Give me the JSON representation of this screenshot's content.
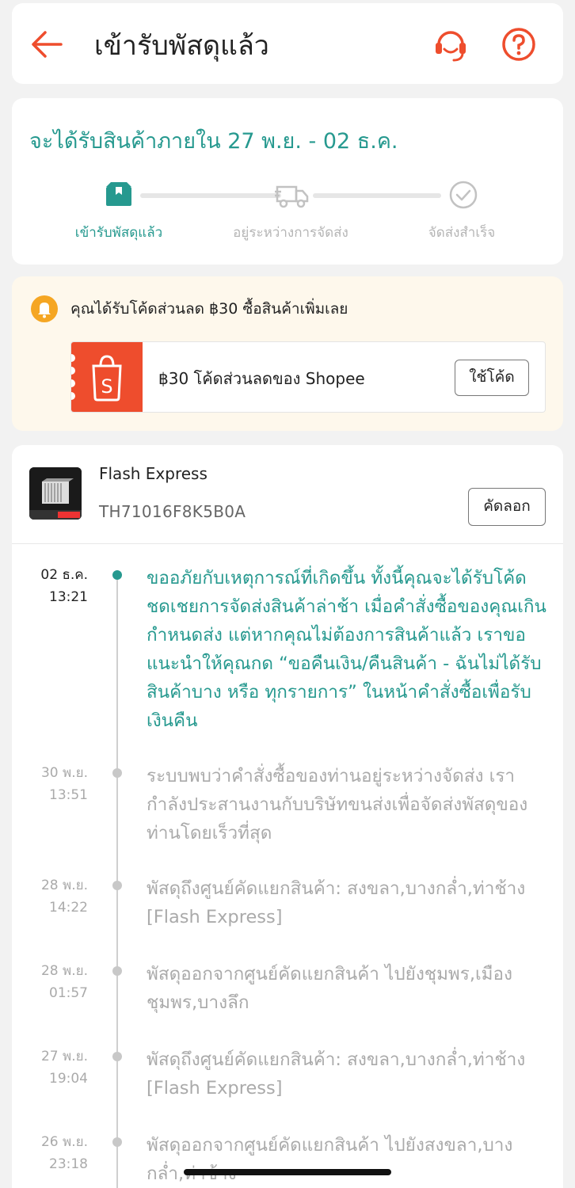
{
  "header": {
    "title": "เข้ารับพัสดุแล้ว"
  },
  "status": {
    "eta": "จะได้รับสินค้าภายใน 27 พ.ย. - 02 ธ.ค.",
    "steps": [
      {
        "label": "เข้ารับพัสดุแล้ว",
        "icon": "package-icon",
        "state": "done"
      },
      {
        "label": "อยู่ระหว่างการจัดส่ง",
        "icon": "truck-icon",
        "state": "pending"
      },
      {
        "label": "จัดส่งสำเร็จ",
        "icon": "check-circle-icon",
        "state": "pending"
      }
    ]
  },
  "voucher": {
    "message": "คุณได้รับโค้ดส่วนลด ฿30 ซื้อสินค้าเพิ่มเลย",
    "coupon_text": "฿30 โค้ดส่วนลดของ Shopee",
    "use_button": "ใช้โค้ด"
  },
  "shipment": {
    "carrier": "Flash Express",
    "tracking_number": "TH71016F8K5B0A",
    "copy_button": "คัดลอก"
  },
  "events": [
    {
      "date": "02 ธ.ค.",
      "time": "13:21",
      "description": "ขออภัยกับเหตุการณ์ที่เกิดขึ้น ทั้งนี้คุณจะได้รับโค้ดชดเชยการจัดส่งสินค้าล่าช้า เมื่อคำสั่งซื้อของคุณเกินกำหนดส่ง แต่หากคุณไม่ต้องการสินค้าแล้ว เราขอแนะนำให้คุณกด “ขอคืนเงิน/คืนสินค้า - ฉันไม่ได้รับสินค้าบาง หรือ ทุกรายการ” ในหน้าคำสั่งซื้อเพื่อรับเงินคืน"
    },
    {
      "date": "30 พ.ย.",
      "time": "13:51",
      "description": "ระบบพบว่าคำสั่งซื้อของท่านอยู่ระหว่างจัดส่ง เรากำลังประสานงานกับบริษัทขนส่งเพื่อจัดส่งพัสดุของท่านโดยเร็วที่สุด"
    },
    {
      "date": "28 พ.ย.",
      "time": "14:22",
      "description": "พัสดุถึงศูนย์คัดแยกสินค้า: สงขลา,บางกล่ำ,ท่าช้าง  [Flash Express]"
    },
    {
      "date": "28 พ.ย.",
      "time": "01:57",
      "description": "พัสดุออกจากศูนย์คัดแยกสินค้า ไปยังชุมพร,เมืองชุมพร,บางลึก"
    },
    {
      "date": "27 พ.ย.",
      "time": "19:04",
      "description": "พัสดุถึงศูนย์คัดแยกสินค้า: สงขลา,บางกล่ำ,ท่าช้าง  [Flash Express]"
    },
    {
      "date": "26 พ.ย.",
      "time": "23:18",
      "description": "พัสดุออกจากศูนย์คัดแยกสินค้า ไปยังสงขลา,บางกล่ำ,ท่าช้าง"
    }
  ],
  "colors": {
    "accent": "#ee4d2d",
    "teal": "#26998f",
    "voucher_bg": "#fef8ec",
    "bell": "#f5a623"
  }
}
